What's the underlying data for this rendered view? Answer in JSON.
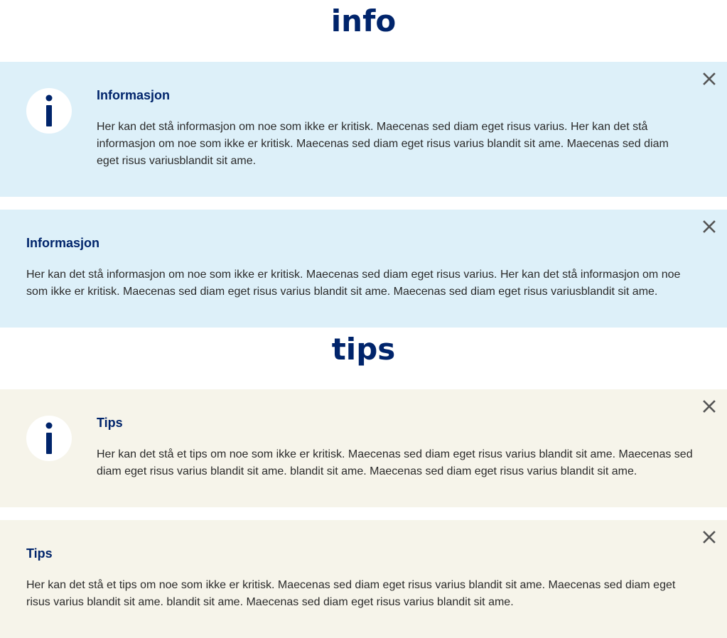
{
  "sections": {
    "info_heading": "info",
    "tips_heading": "tips"
  },
  "alerts": [
    {
      "variant": "info",
      "has_icon": true,
      "title": "Informasjon",
      "body": "Her kan det stå informasjon om noe som ikke er kritisk. Maecenas sed diam eget risus varius. Her kan det stå informasjon om noe som ikke er kritisk. Maecenas sed diam eget risus varius blandit sit ame. Maecenas sed diam eget risus variusblandit sit ame.",
      "icon": "info-icon",
      "close_icon": "close-icon"
    },
    {
      "variant": "info",
      "has_icon": false,
      "title": "Informasjon",
      "body": "Her kan det stå informasjon om noe som ikke er kritisk. Maecenas sed diam eget risus varius. Her kan det stå informasjon om noe som ikke er kritisk. Maecenas sed diam eget risus varius blandit sit ame. Maecenas sed diam eget risus variusblandit sit ame.",
      "close_icon": "close-icon"
    },
    {
      "variant": "tips",
      "has_icon": true,
      "title": "Tips",
      "body": "Her kan det stå et tips om noe som ikke er kritisk. Maecenas sed diam eget risus varius blandit sit ame. Maecenas sed diam eget risus varius blandit sit ame. blandit sit ame. Maecenas sed diam eget risus varius blandit sit ame.",
      "icon": "info-icon",
      "close_icon": "close-icon"
    },
    {
      "variant": "tips",
      "has_icon": false,
      "title": "Tips",
      "body": "Her kan det stå et tips om noe som ikke er kritisk. Maecenas sed diam eget risus varius blandit sit ame. Maecenas sed diam eget risus varius blandit sit ame. blandit sit ame. Maecenas sed diam eget risus varius blandit sit ame.",
      "close_icon": "close-icon"
    }
  ],
  "colors": {
    "brand_blue": "#00246b",
    "info_background": "#ddf0f9",
    "tips_background": "#f6f4ea",
    "close_icon": "#555555"
  }
}
